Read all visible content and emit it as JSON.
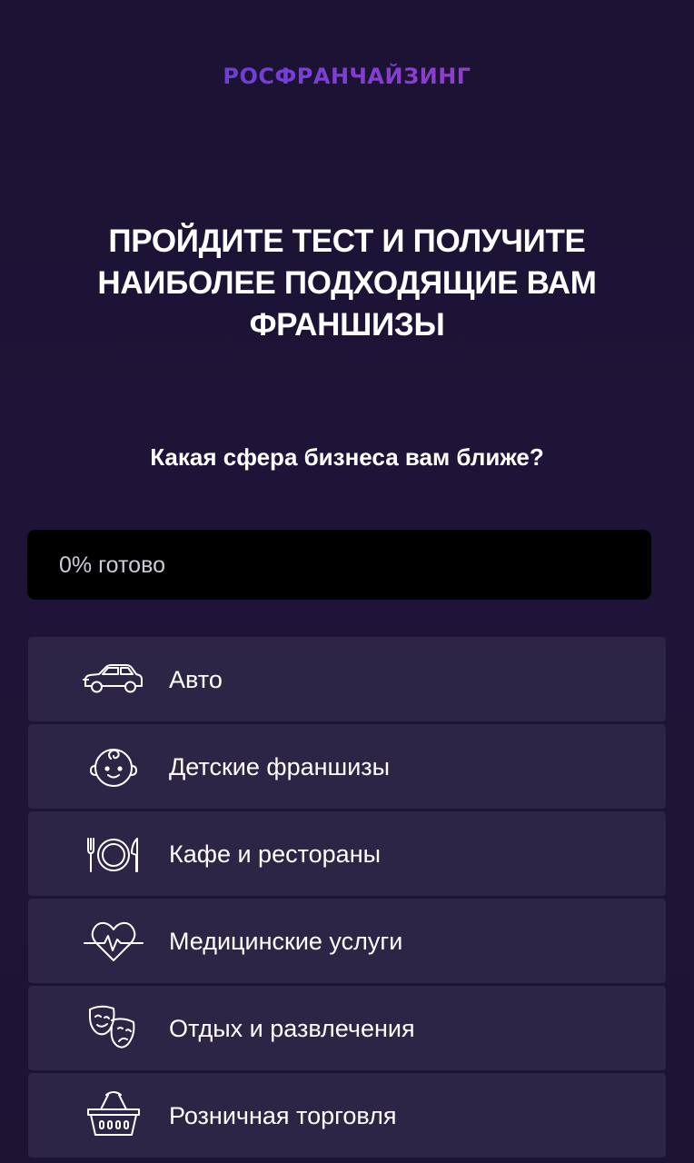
{
  "brand": {
    "logo_text": "РОСФРАНЧАЙЗИНГ"
  },
  "headline": {
    "line1": "ПРОЙДИТЕ ТЕСТ И ПОЛУЧИТЕ",
    "line2": "НАИБОЛЕЕ ПОДХОДЯЩИЕ ВАМ",
    "line3": "ФРАНШИЗЫ"
  },
  "question": "Какая сфера бизнеса вам ближе?",
  "progress": {
    "label": "0% готово",
    "value": 0
  },
  "options": [
    {
      "label": "Авто",
      "icon": "car-icon"
    },
    {
      "label": "Детские франшизы",
      "icon": "baby-face-icon"
    },
    {
      "label": "Кафе и рестораны",
      "icon": "plate-cutlery-icon"
    },
    {
      "label": "Медицинские услуги",
      "icon": "heart-pulse-icon"
    },
    {
      "label": "Отдых и развлечения",
      "icon": "theater-masks-icon"
    },
    {
      "label": "Розничная торговля",
      "icon": "shopping-basket-icon"
    }
  ],
  "colors": {
    "background": "#1d1333",
    "option_background": "#2c2546",
    "progress_background": "#000000",
    "logo_gradient_start": "#4a3fd1",
    "logo_gradient_end": "#b43ab8"
  }
}
